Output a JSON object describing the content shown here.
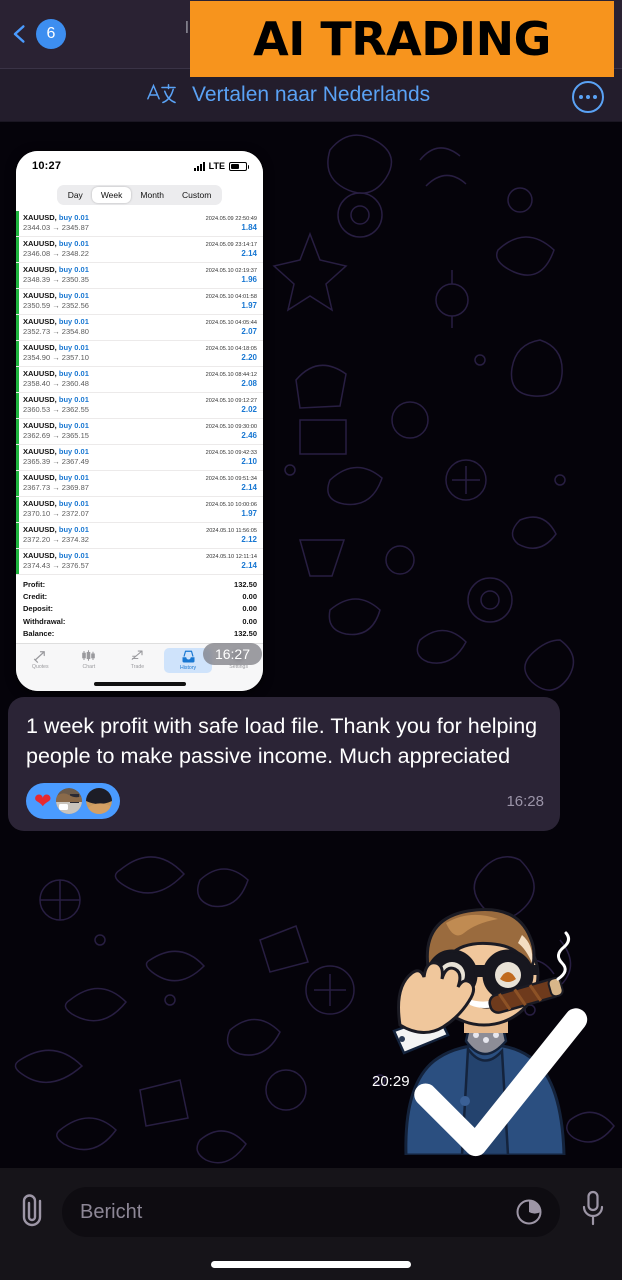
{
  "header": {
    "back_icon": "chevron-left-icon",
    "unread_badge": "6",
    "obscured_title": "l",
    "ai_banner_text": "AI TRADING",
    "ai_banner_color": "#f7941d"
  },
  "translate_bar": {
    "icon": "translate-icon",
    "label": "Vertalen naar Nederlands",
    "more_icon": "more-circle-icon",
    "accent_color": "#5aa2f5"
  },
  "screenshot_card": {
    "status_bar": {
      "time": "10:27",
      "signal_icon": "cellular-bars-icon",
      "network": "LTE",
      "battery_icon": "battery-icon"
    },
    "segments": [
      {
        "label": "Day",
        "active": false
      },
      {
        "label": "Week",
        "active": true
      },
      {
        "label": "Month",
        "active": false
      },
      {
        "label": "Custom",
        "active": false
      }
    ],
    "trades": [
      {
        "symbol": "XAUUSD,",
        "action": "buy 0.01",
        "date": "2024.05.09 22:50:49",
        "open": "2344.03",
        "close": "2345.87",
        "profit": "1.84"
      },
      {
        "symbol": "XAUUSD,",
        "action": "buy 0.01",
        "date": "2024.05.09 23:14:17",
        "open": "2346.08",
        "close": "2348.22",
        "profit": "2.14"
      },
      {
        "symbol": "XAUUSD,",
        "action": "buy 0.01",
        "date": "2024.05.10 02:19:37",
        "open": "2348.39",
        "close": "2350.35",
        "profit": "1.96"
      },
      {
        "symbol": "XAUUSD,",
        "action": "buy 0.01",
        "date": "2024.05.10 04:01:58",
        "open": "2350.59",
        "close": "2352.56",
        "profit": "1.97"
      },
      {
        "symbol": "XAUUSD,",
        "action": "buy 0.01",
        "date": "2024.05.10 04:05:44",
        "open": "2352.73",
        "close": "2354.80",
        "profit": "2.07"
      },
      {
        "symbol": "XAUUSD,",
        "action": "buy 0.01",
        "date": "2024.05.10 04:18:05",
        "open": "2354.90",
        "close": "2357.10",
        "profit": "2.20"
      },
      {
        "symbol": "XAUUSD,",
        "action": "buy 0.01",
        "date": "2024.05.10 08:44:12",
        "open": "2358.40",
        "close": "2360.48",
        "profit": "2.08"
      },
      {
        "symbol": "XAUUSD,",
        "action": "buy 0.01",
        "date": "2024.05.10 09:12:27",
        "open": "2360.53",
        "close": "2362.55",
        "profit": "2.02"
      },
      {
        "symbol": "XAUUSD,",
        "action": "buy 0.01",
        "date": "2024.05.10 09:30:00",
        "open": "2362.69",
        "close": "2365.15",
        "profit": "2.46"
      },
      {
        "symbol": "XAUUSD,",
        "action": "buy 0.01",
        "date": "2024.05.10 09:42:33",
        "open": "2365.39",
        "close": "2367.49",
        "profit": "2.10"
      },
      {
        "symbol": "XAUUSD,",
        "action": "buy 0.01",
        "date": "2024.05.10 09:51:34",
        "open": "2367.73",
        "close": "2369.87",
        "profit": "2.14"
      },
      {
        "symbol": "XAUUSD,",
        "action": "buy 0.01",
        "date": "2024.05.10 10:00:06",
        "open": "2370.10",
        "close": "2372.07",
        "profit": "1.97"
      },
      {
        "symbol": "XAUUSD,",
        "action": "buy 0.01",
        "date": "2024.05.10 11:56:05",
        "open": "2372.20",
        "close": "2374.32",
        "profit": "2.12"
      },
      {
        "symbol": "XAUUSD,",
        "action": "buy 0.01",
        "date": "2024.05.10 12:11:14",
        "open": "2374.43",
        "close": "2376.57",
        "profit": "2.14"
      }
    ],
    "summary": [
      {
        "label": "Profit:",
        "value": "132.50"
      },
      {
        "label": "Credit:",
        "value": "0.00"
      },
      {
        "label": "Deposit:",
        "value": "0.00"
      },
      {
        "label": "Withdrawal:",
        "value": "0.00"
      },
      {
        "label": "Balance:",
        "value": "132.50"
      }
    ],
    "tabs": [
      {
        "label": "Quotes",
        "icon": "quotes-icon",
        "active": false
      },
      {
        "label": "Chart",
        "icon": "chart-icon",
        "active": false
      },
      {
        "label": "Trade",
        "icon": "trade-icon",
        "active": false
      },
      {
        "label": "History",
        "icon": "history-icon",
        "active": true
      },
      {
        "label": "Settings",
        "icon": "gear-icon",
        "active": false
      }
    ],
    "overlay_time": "16:27"
  },
  "message": {
    "text": "1 week profit with safe load file. Thank you for helping people to make passive income. Much appreciated",
    "time": "16:28",
    "reaction": {
      "emoji": "❤",
      "icon": "heart-reaction-icon",
      "color": "#4a9bff"
    }
  },
  "sticker": {
    "name": "man-with-sunglasses-and-cigar-sticker",
    "time": "20:29",
    "status_icon": "sent-check-icon"
  },
  "input_bar": {
    "attach_icon": "paperclip-icon",
    "placeholder": "Bericht",
    "emoji_icon": "sticker-icon",
    "mic_icon": "microphone-icon"
  }
}
